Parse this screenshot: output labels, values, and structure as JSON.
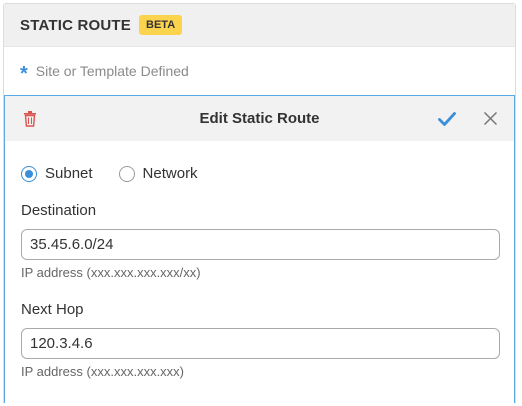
{
  "section": {
    "title": "STATIC ROUTE",
    "badge": "BETA",
    "inherited_text": "Site or Template Defined"
  },
  "edit_panel": {
    "title": "Edit Static Route",
    "type_options": [
      {
        "label": "Subnet",
        "selected": true
      },
      {
        "label": "Network",
        "selected": false
      }
    ],
    "destination": {
      "label": "Destination",
      "value": "35.45.6.0/24",
      "hint": "IP address (xxx.xxx.xxx.xxx/xx)"
    },
    "next_hop": {
      "label": "Next Hop",
      "value": "120.3.4.6",
      "hint": "IP address (xxx.xxx.xxx.xxx)"
    }
  },
  "colors": {
    "accent": "#3a8fd8",
    "badge": "#fcd34d",
    "delete": "#d9534f"
  },
  "icons": [
    "trash-icon",
    "checkmark-icon",
    "close-icon",
    "asterisk-icon"
  ]
}
